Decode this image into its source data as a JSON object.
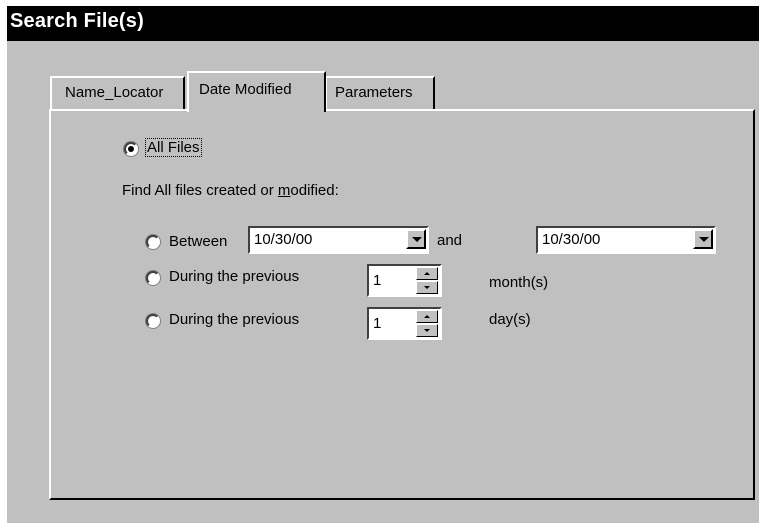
{
  "window": {
    "title": "Search File(s)"
  },
  "tabs": [
    {
      "label": "Name_Locator",
      "selected": false
    },
    {
      "label": "Date Modified",
      "selected": true
    },
    {
      "label": "Parameters",
      "selected": false
    }
  ],
  "date_modified": {
    "all_files": {
      "label": "All Files",
      "selected": true
    },
    "find_label_prefix": "Find All files created or ",
    "find_label_underlined": "m",
    "find_label_suffix": "odified:",
    "between": {
      "label": "Between",
      "selected": false,
      "start_date": "10/30/00",
      "and_label": "and",
      "end_date": "10/30/00"
    },
    "previous_months": {
      "label": "During the previous",
      "selected": false,
      "value": "1",
      "unit": "month(s)"
    },
    "previous_days": {
      "label": "During the previous",
      "selected": false,
      "value": "1",
      "unit": "day(s)"
    }
  },
  "icons": [
    "dropdown-arrow-icon",
    "spin-up-icon",
    "spin-down-icon"
  ]
}
